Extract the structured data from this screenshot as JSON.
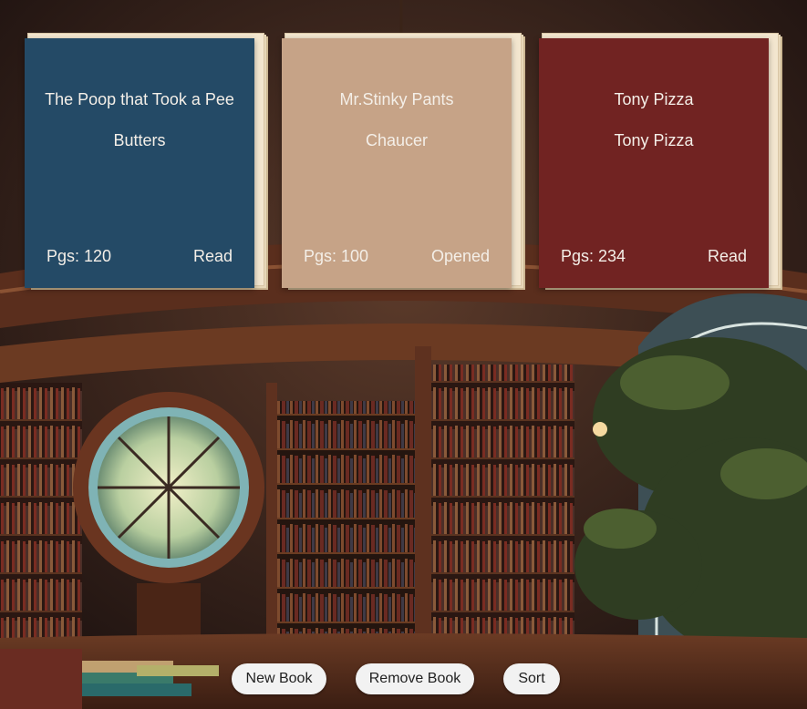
{
  "books": [
    {
      "title": "The Poop that Took a Pee",
      "author": "Butters",
      "pages": "Pgs: 120",
      "status": "Read",
      "color": "#244a66"
    },
    {
      "title": "Mr.Stinky Pants",
      "author": "Chaucer",
      "pages": "Pgs: 100",
      "status": "Opened",
      "color": "#c6a387"
    },
    {
      "title": "Tony Pizza",
      "author": "Tony Pizza",
      "pages": "Pgs: 234",
      "status": "Read",
      "color": "#712322"
    }
  ],
  "controls": {
    "new_book": "New Book",
    "remove_book": "Remove Book",
    "sort": "Sort"
  },
  "background": {
    "scene": "fantasy-library-illustration"
  }
}
